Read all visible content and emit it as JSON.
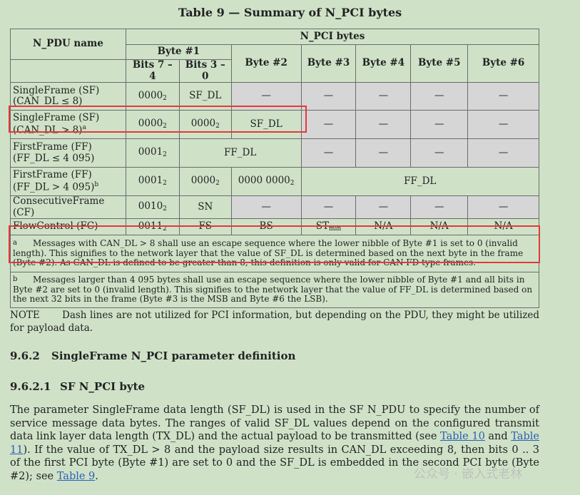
{
  "caption": "Table 9 — Summary of N_PCI bytes",
  "table": {
    "head": {
      "col_npdu": "N_PDU name",
      "group": "N_PCI bytes",
      "byte1": "Byte #1",
      "bits74": "Bits 7 – 4",
      "bits30": "Bits 3 – 0",
      "byte2": "Byte #2",
      "byte3": "Byte #3",
      "byte4": "Byte #4",
      "byte5": "Byte #5",
      "byte6": "Byte #6"
    },
    "dash": "—",
    "sub2": "2",
    "sf1": {
      "name1": "SingleFrame (SF)",
      "name2": "(CAN_DL ≤ 8)",
      "b74": "0000",
      "b30": "SF_DL"
    },
    "sf2": {
      "name1": "SingleFrame (SF)",
      "name2": "(CAN_DL > 8)",
      "mark": "a",
      "b74": "0000",
      "b30": "0000",
      "byte2": "SF_DL"
    },
    "ff1": {
      "name1": "FirstFrame (FF)",
      "name2": "(FF_DL ≤ 4 095)",
      "b74": "0001",
      "span": "FF_DL"
    },
    "ff2": {
      "name1": "FirstFrame (FF)",
      "name2": "(FF_DL > 4 095)",
      "mark": "b",
      "b74": "0001",
      "b30": "0000",
      "byte2": "0000 0000",
      "span": "FF_DL"
    },
    "cf": {
      "name": "ConsecutiveFrame (CF)",
      "b74": "0010",
      "b30": "SN"
    },
    "fc": {
      "name": "FlowControl (FC)",
      "b74": "0011",
      "b30": "FS",
      "byte2": "BS",
      "st": "ST",
      "st_sub": "min",
      "byte4": "N/A",
      "byte5": "N/A",
      "byte6": "N/A"
    },
    "footnote_a": {
      "mark": "a",
      "text": "Messages with CAN_DL > 8 shall use an escape sequence where the lower nibble of Byte #1 is set to 0 (invalid length). This signifies to the network layer that the value of SF_DL is determined based on the next byte in the frame (Byte #2). As CAN_DL is defined to be greater than 8, this definition is only valid for CAN FD type frames."
    },
    "footnote_b": {
      "mark": "b",
      "text": "Messages larger than 4 095 bytes shall use an escape sequence where the lower nibble of Byte #1 and all bits in Byte #2 are set to 0 (invalid length). This signifies to the network layer that the value of FF_DL is determined based on the next 32 bits in the frame (Byte #3 is the MSB and Byte #6 the LSB)."
    }
  },
  "note": {
    "label": "NOTE",
    "text": "Dash lines are not utilized for PCI information, but depending on the PDU, they might be utilized for payload data."
  },
  "section_962": {
    "num": "9.6.2",
    "title": "SingleFrame N_PCI parameter definition"
  },
  "section_9621": {
    "num": "9.6.2.1",
    "title": "SF N_PCI byte"
  },
  "paragraph": {
    "t1": "The parameter SingleFrame data length (SF_DL) is used in the SF N_PDU to specify the number of service message data bytes. The ranges of valid SF_DL values depend on the configured transmit data link layer data length (TX_DL) and the actual payload to be transmitted (see ",
    "link1": "Table 10",
    "t2": " and ",
    "link2": "Table 11",
    "t3": "). If the value of TX_DL > 8 and the payload size results in CAN_DL exceeding 8, then bits 0 .. 3 of the first PCI byte (Byte #1) are set to 0 and the SF_DL is embedded in the second PCI byte (Byte #2); see ",
    "link3": "Table 9",
    "t4": "."
  },
  "watermark": "公众号 · 嵌入式老林"
}
